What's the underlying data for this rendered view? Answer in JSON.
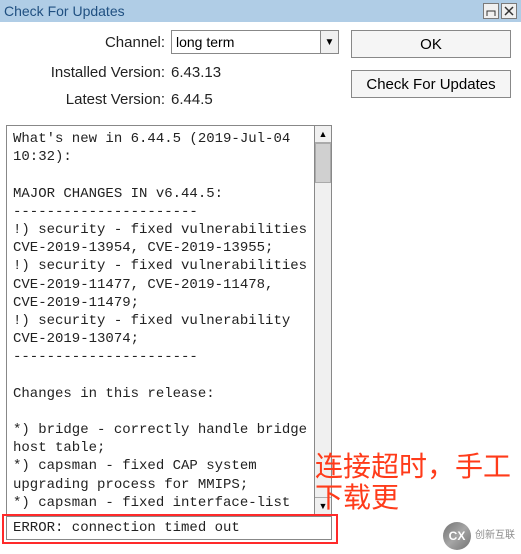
{
  "window": {
    "title": "Check For Updates"
  },
  "form": {
    "channel_label": "Channel:",
    "channel_value": "long term",
    "installed_label": "Installed Version:",
    "installed_value": "6.43.13",
    "latest_label": "Latest Version:",
    "latest_value": "6.44.5"
  },
  "buttons": {
    "ok": "OK",
    "check": "Check For Updates"
  },
  "changelog": "What's new in 6.44.5 (2019-Jul-04 10:32):\n\nMAJOR CHANGES IN v6.44.5:\n----------------------\n!) security - fixed vulnerabilities CVE-2019-13954, CVE-2019-13955;\n!) security - fixed vulnerabilities CVE-2019-11477, CVE-2019-11478, CVE-2019-11479;\n!) security - fixed vulnerability CVE-2019-13074;\n----------------------\n\nChanges in this release:\n\n*) bridge - correctly handle bridge host table;\n*) capsman - fixed CAP system upgrading process for MMIPS;\n*) capsman - fixed interface-list usage in access list;\n*) certificate - removed \"set-ca-passphrase\" parameter;\n*) cloud - properly stop \"time-zone-",
  "status": "ERROR: connection timed out",
  "annotation": {
    "line1": "连接超时，手工",
    "line2": "下载更"
  },
  "watermark": {
    "icon": "CX",
    "text": "创新互联"
  }
}
